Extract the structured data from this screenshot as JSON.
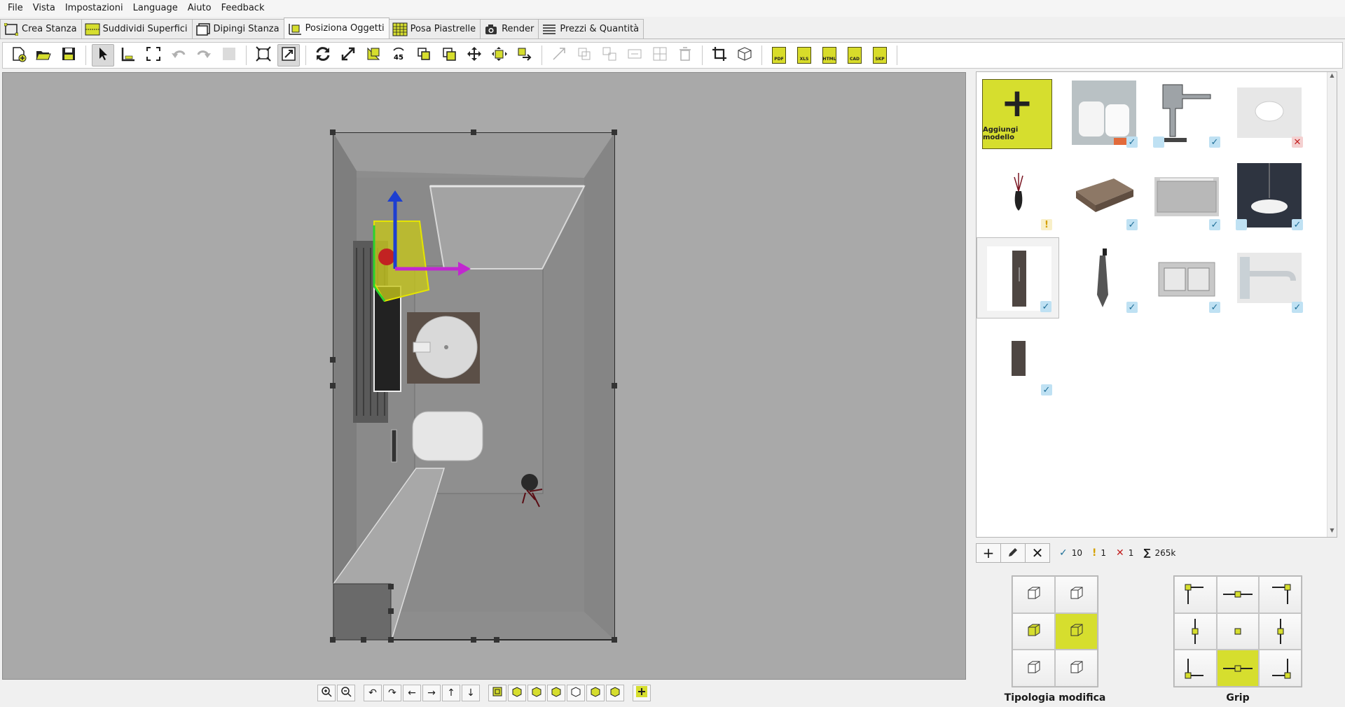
{
  "menu": [
    "File",
    "Vista",
    "Impostazioni",
    "Language",
    "Aiuto",
    "Feedback"
  ],
  "tabs": [
    {
      "label": "Crea Stanza",
      "icon": "room-outline-icon",
      "active": false
    },
    {
      "label": "Suddividi Superfici",
      "icon": "surface-split-icon",
      "active": false
    },
    {
      "label": "Dipingi Stanza",
      "icon": "paint-room-icon",
      "active": false
    },
    {
      "label": "Posiziona Oggetti",
      "icon": "place-objects-icon",
      "active": true
    },
    {
      "label": "Posa Piastrelle",
      "icon": "tiles-grid-icon",
      "active": false
    },
    {
      "label": "Render",
      "icon": "camera-icon",
      "active": false
    },
    {
      "label": "Prezzi & Quantità",
      "icon": "list-icon",
      "active": false
    }
  ],
  "toolbar": {
    "doc_labels": [
      "PDF",
      "XLS",
      "HTML",
      "CAD",
      "SKP"
    ]
  },
  "catalog": {
    "add_model_label": "Aggiungi modello",
    "items": [
      {
        "name": "wc-bidet",
        "status": "ok"
      },
      {
        "name": "faucet",
        "status": "ok",
        "hidden": true
      },
      {
        "name": "washbasin",
        "status": "err"
      },
      {
        "name": "vase-plant",
        "status": "warn"
      },
      {
        "name": "wood-top",
        "status": "ok"
      },
      {
        "name": "mirror",
        "status": "ok"
      },
      {
        "name": "pendant-lamp",
        "status": "ok",
        "hidden": true
      },
      {
        "name": "tall-cabinet",
        "status": "ok",
        "selected": true
      },
      {
        "name": "towel-hook",
        "status": "ok"
      },
      {
        "name": "flush-plate",
        "status": "ok"
      },
      {
        "name": "wall-spout",
        "status": "ok"
      },
      {
        "name": "door-panel",
        "status": "ok"
      }
    ]
  },
  "stats": {
    "ok": "10",
    "warn": "1",
    "err": "1",
    "sum_symbol": "∑",
    "sum": "265k"
  },
  "labels": {
    "tipologia": "Tipologia modifica",
    "grip": "Grip"
  },
  "colors": {
    "accent": "#d6de2e",
    "ok": "#1f6f98",
    "warn": "#d4a000",
    "err": "#c21e1e"
  }
}
